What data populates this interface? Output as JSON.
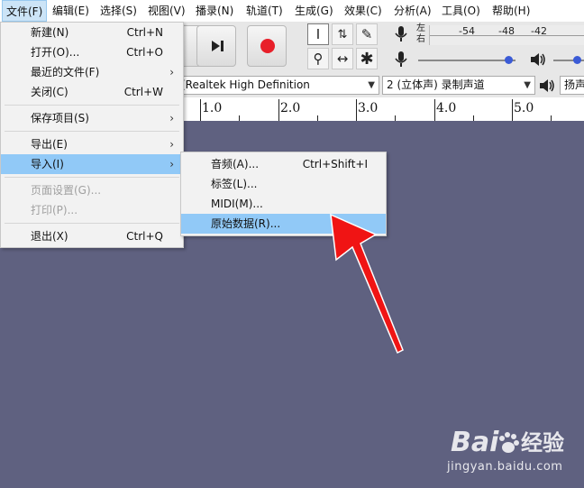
{
  "menubar": {
    "items": [
      "文件(F)",
      "编辑(E)",
      "选择(S)",
      "视图(V)",
      "播录(N)",
      "轨道(T)",
      "生成(G)",
      "效果(C)",
      "分析(A)",
      "工具(O)",
      "帮助(H)"
    ]
  },
  "meters": {
    "record_left": "左",
    "record_right": "右",
    "scale": [
      "-54",
      "-48",
      "-42"
    ]
  },
  "device_bar": {
    "input_device": "(Realtek High Definition",
    "channels": "2 (立体声) 录制声道",
    "output_device": "扬声"
  },
  "ruler": {
    "labels": [
      "1.0",
      "2.0",
      "3.0",
      "4.0",
      "5.0"
    ]
  },
  "file_menu": {
    "items": [
      {
        "label": "新建(N)",
        "shortcut": "Ctrl+N",
        "submenu": false,
        "disabled": false
      },
      {
        "label": "打开(O)...",
        "shortcut": "Ctrl+O",
        "submenu": false,
        "disabled": false
      },
      {
        "label": "最近的文件(F)",
        "shortcut": "",
        "submenu": true,
        "disabled": false
      },
      {
        "label": "关闭(C)",
        "shortcut": "Ctrl+W",
        "submenu": false,
        "disabled": false
      },
      {
        "label": "保存项目(S)",
        "shortcut": "",
        "submenu": true,
        "disabled": false
      },
      {
        "label": "导出(E)",
        "shortcut": "",
        "submenu": true,
        "disabled": false
      },
      {
        "label": "导入(I)",
        "shortcut": "",
        "submenu": true,
        "disabled": false
      },
      {
        "label": "页面设置(G)...",
        "shortcut": "",
        "submenu": false,
        "disabled": true
      },
      {
        "label": "打印(P)...",
        "shortcut": "",
        "submenu": false,
        "disabled": true
      },
      {
        "label": "退出(X)",
        "shortcut": "Ctrl+Q",
        "submenu": false,
        "disabled": false
      }
    ]
  },
  "import_menu": {
    "items": [
      {
        "label": "音频(A)...",
        "shortcut": "Ctrl+Shift+I"
      },
      {
        "label": "标签(L)...",
        "shortcut": ""
      },
      {
        "label": "MIDI(M)...",
        "shortcut": ""
      },
      {
        "label": "原始数据(R)...",
        "shortcut": ""
      }
    ]
  },
  "submenu_arrow": "›",
  "watermark": {
    "brand_left": "Bai",
    "brand_right": "经验",
    "url": "jingyan.baidu.com"
  },
  "colors": {
    "track_area": "#5f6180",
    "highlight": "#91c9f7",
    "record_red": "#e8202a",
    "annotation_arrow": "#f01414"
  }
}
